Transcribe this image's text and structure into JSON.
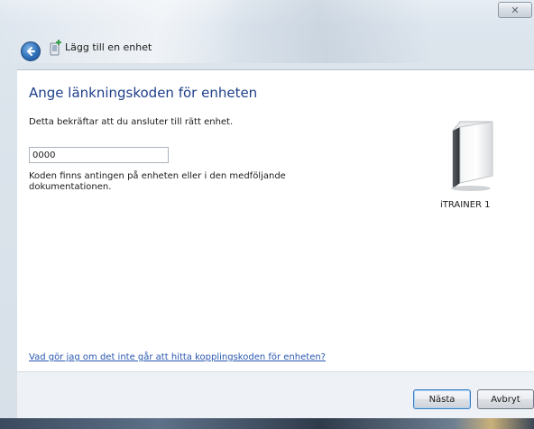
{
  "window": {
    "title": "Lägg till en enhet",
    "close_symbol": "✕"
  },
  "page": {
    "heading": "Ange länkningskoden för enheten",
    "description": "Detta bekräftar att du ansluter till rätt enhet.",
    "code_value": "0000",
    "hint": "Koden finns antingen på enheten eller i den medföljande dokumentationen.",
    "help_link": "Vad gör jag om det inte går att hitta kopplingskoden för enheten?"
  },
  "device": {
    "name": "iTRAINER 1",
    "icon": "external-drive-icon"
  },
  "buttons": {
    "next": "Nästa",
    "cancel": "Avbryt"
  }
}
